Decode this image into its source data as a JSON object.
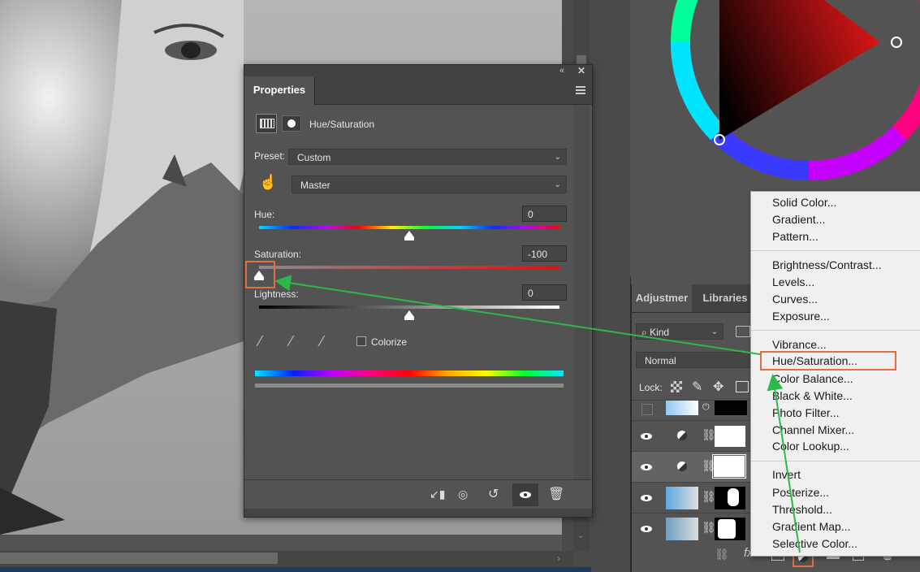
{
  "properties_panel": {
    "tab_label": "Properties",
    "header_collapse": "«",
    "header_close": "✕",
    "adjustment_title": "Hue/Saturation",
    "preset_label": "Preset:",
    "preset_value": "Custom",
    "channel_value": "Master",
    "hue_label": "Hue:",
    "hue_value": "0",
    "saturation_label": "Saturation:",
    "saturation_value": "-100",
    "lightness_label": "Lightness:",
    "lightness_value": "0",
    "colorize_label": "Colorize",
    "colorize_checked": false,
    "hue_slider_fraction": 0.5,
    "saturation_slider_fraction": 0.0,
    "lightness_slider_fraction": 0.5
  },
  "layers_panel": {
    "tabs": [
      "Adjustmer",
      "Libraries"
    ],
    "filter_kind": "Kind",
    "blend_mode": "Normal",
    "lock_label": "Lock:",
    "bottom_fx": "fx"
  },
  "adjustment_menu": {
    "group1": [
      "Solid Color...",
      "Gradient...",
      "Pattern..."
    ],
    "group2": [
      "Brightness/Contrast...",
      "Levels...",
      "Curves...",
      "Exposure..."
    ],
    "group3": [
      "Vibrance...",
      "Hue/Saturation...",
      "Color Balance...",
      "Black & White...",
      "Photo Filter...",
      "Channel Mixer...",
      "Color Lookup..."
    ],
    "group4": [
      "Invert",
      "Posterize...",
      "Threshold...",
      "Gradient Map...",
      "Selective Color..."
    ],
    "highlighted_item": "Hue/Saturation..."
  },
  "colors": {
    "panel_bg": "#535353",
    "dark_bg": "#424242",
    "menu_bg": "#f0f0f0",
    "highlight_box": "#e07040",
    "arrow": "#2db84a"
  },
  "icons": {
    "targeted_adjustment": "hand-scrubby-icon",
    "eyedroppers": [
      "eyedropper-icon",
      "eyedropper-plus-icon",
      "eyedropper-minus-icon"
    ],
    "footer": [
      "clip-to-layer-icon",
      "view-previous-icon",
      "reset-icon",
      "visibility-icon",
      "trash-icon"
    ]
  }
}
